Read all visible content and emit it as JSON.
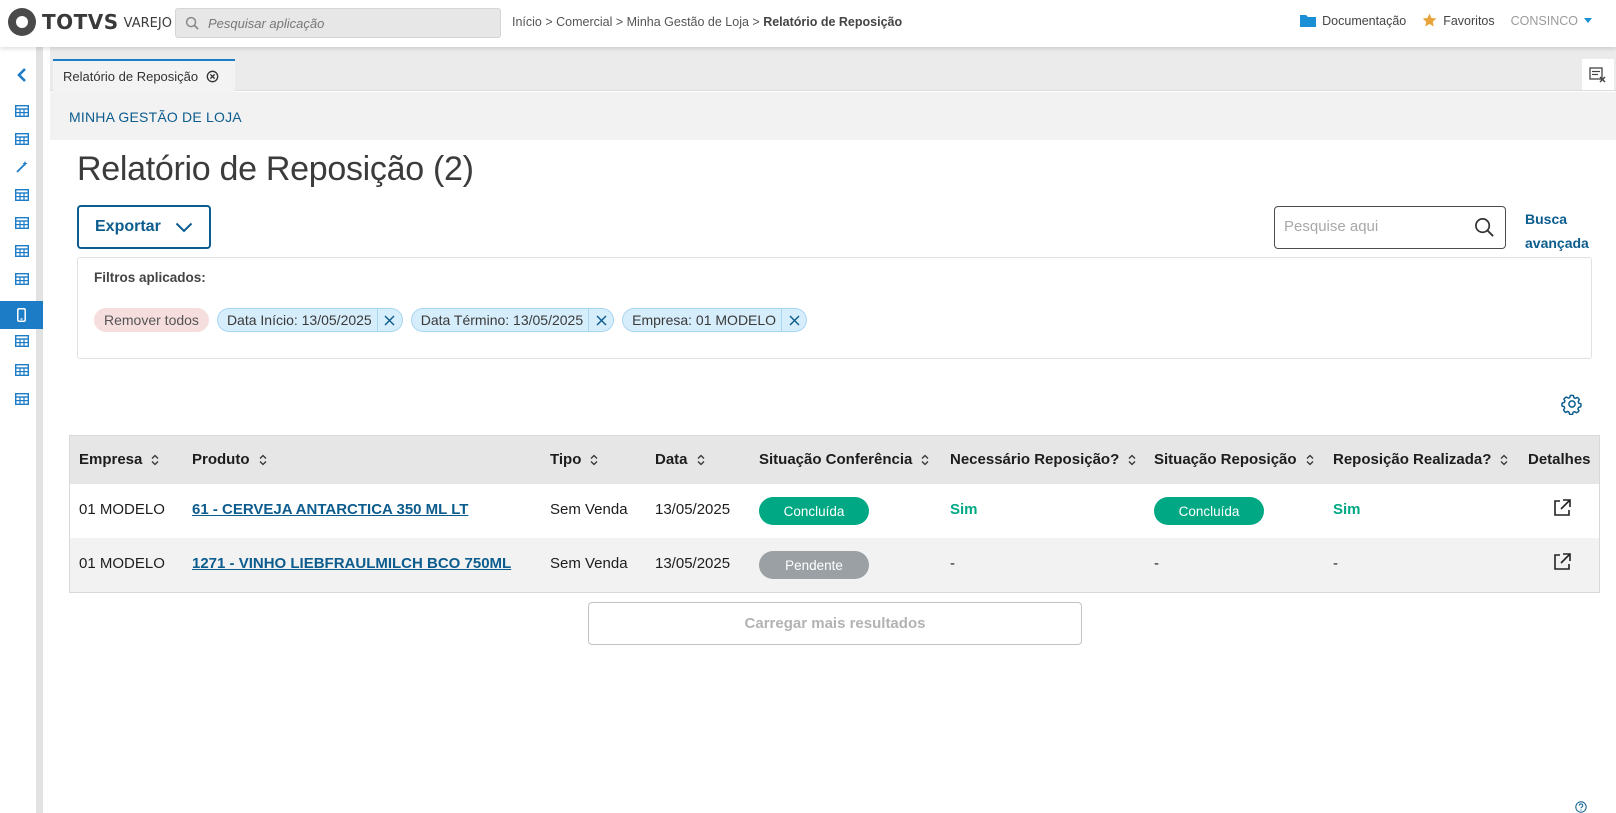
{
  "brand": {
    "name": "TOTVS",
    "product": "VAREJO"
  },
  "app_search": {
    "placeholder": "Pesquisar aplicação"
  },
  "breadcrumb": {
    "path": "Início > Comercial > Minha Gestão de Loja > ",
    "current": "Relatório de Reposição"
  },
  "top_links": {
    "docs": "Documentação",
    "favorites": "Favoritos",
    "user": "CONSINCO"
  },
  "colors": {
    "accent": "#0c5c8e",
    "primary": "#1d7cc6",
    "success": "#00a884",
    "neutral": "#9aa0a3",
    "remove_chip": "#f6dede",
    "filter_chip": "#d6edfb"
  },
  "tab": {
    "label": "Relatório de Reposição"
  },
  "section": {
    "title": "MINHA GESTÃO DE LOJA"
  },
  "page": {
    "title": "Relatório de Reposição (2)"
  },
  "toolbar": {
    "export_label": "Exportar",
    "search_placeholder": "Pesquise aqui",
    "advanced_line1": "Busca",
    "advanced_line2": "avançada"
  },
  "filters": {
    "label": "Filtros aplicados:",
    "remove_all": "Remover todos",
    "chips": [
      "Data Início: 13/05/2025",
      "Data Término: 13/05/2025",
      "Empresa: 01 MODELO"
    ]
  },
  "table": {
    "columns": [
      "Empresa",
      "Produto",
      "Tipo",
      "Data",
      "Situação Conferência",
      "Necessário Reposição?",
      "Situação Reposição",
      "Reposição Realizada?",
      "Detalhes"
    ],
    "rows": [
      {
        "empresa": "01 MODELO",
        "produto": "61 - CERVEJA ANTARCTICA 350 ML LT",
        "tipo": "Sem Venda",
        "data": "13/05/2025",
        "situacao_conferencia": "Concluída",
        "necessario_reposicao": "Sim",
        "situacao_reposicao": "Concluída",
        "reposicao_realizada": "Sim"
      },
      {
        "empresa": "01 MODELO",
        "produto": "1271 - VINHO LIEBFRAULMILCH BCO 750ML",
        "tipo": "Sem Venda",
        "data": "13/05/2025",
        "situacao_conferencia": "Pendente",
        "necessario_reposicao": "-",
        "situacao_reposicao": "-",
        "reposicao_realizada": "-"
      }
    ]
  },
  "load_more": {
    "label": "Carregar mais resultados"
  }
}
